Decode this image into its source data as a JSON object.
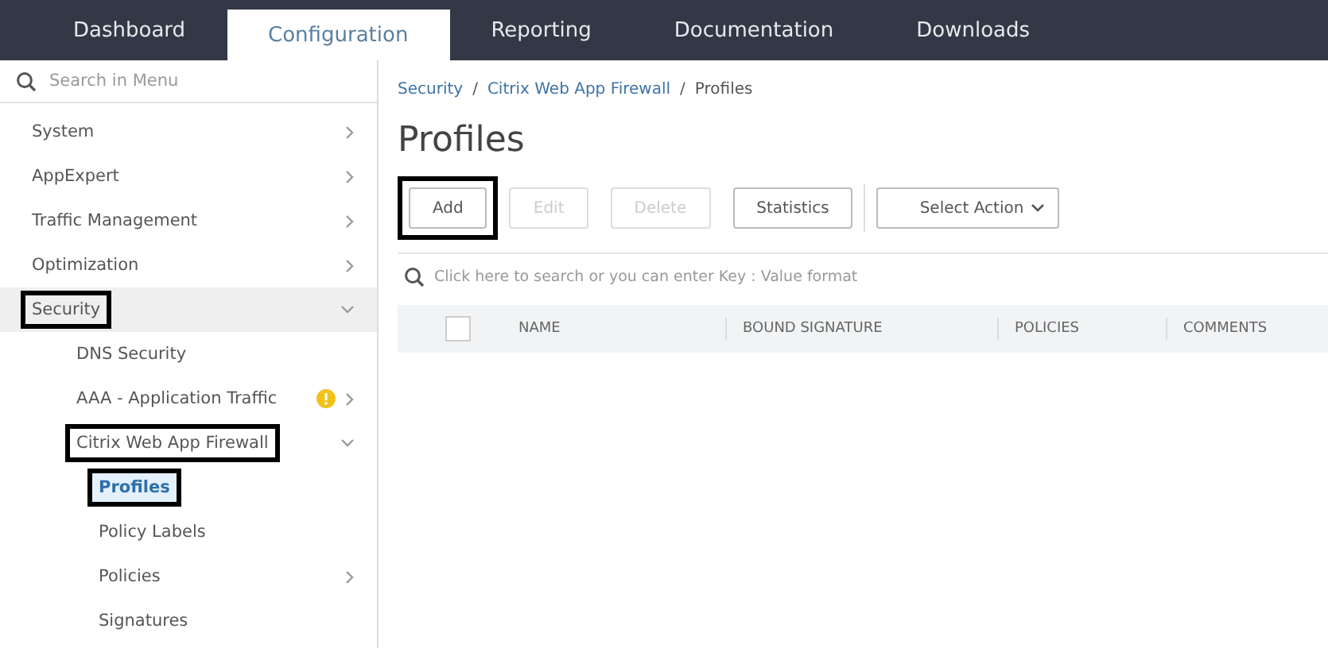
{
  "top_nav": {
    "tabs": [
      {
        "label": "Dashboard",
        "selected": false
      },
      {
        "label": "Configuration",
        "selected": true
      },
      {
        "label": "Reporting",
        "selected": false
      },
      {
        "label": "Documentation",
        "selected": false
      },
      {
        "label": "Downloads",
        "selected": false
      }
    ]
  },
  "sidebar": {
    "search": {
      "placeholder": "Search in Menu"
    },
    "items": [
      {
        "label": "System",
        "kind": "folder",
        "expanded": false,
        "selected": false,
        "highlighted": false,
        "alert": false
      },
      {
        "label": "AppExpert",
        "kind": "folder",
        "expanded": false,
        "selected": false,
        "highlighted": false,
        "alert": false
      },
      {
        "label": "Traffic Management",
        "kind": "folder",
        "expanded": false,
        "selected": false,
        "highlighted": false,
        "alert": false
      },
      {
        "label": "Optimization",
        "kind": "folder",
        "expanded": false,
        "selected": false,
        "highlighted": false,
        "alert": false
      },
      {
        "label": "Security",
        "kind": "folder",
        "expanded": true,
        "selected": false,
        "highlighted": true,
        "alert": false,
        "children": [
          {
            "label": "DNS Security",
            "kind": "page",
            "selected": false,
            "highlighted": false,
            "alert": false
          },
          {
            "label": "AAA - Application Traffic",
            "kind": "folder",
            "expanded": false,
            "selected": false,
            "highlighted": false,
            "alert": true
          },
          {
            "label": "Citrix Web App Firewall",
            "kind": "folder",
            "expanded": true,
            "selected": false,
            "highlighted": true,
            "alert": false,
            "children": [
              {
                "label": "Profiles",
                "kind": "page",
                "selected": true,
                "highlighted": true,
                "alert": false
              },
              {
                "label": "Policy Labels",
                "kind": "page",
                "selected": false,
                "highlighted": false,
                "alert": false
              },
              {
                "label": "Policies",
                "kind": "folder",
                "expanded": false,
                "selected": false,
                "highlighted": false,
                "alert": false
              },
              {
                "label": "Signatures",
                "kind": "page",
                "selected": false,
                "highlighted": false,
                "alert": false
              }
            ]
          }
        ]
      }
    ]
  },
  "main": {
    "breadcrumb": [
      {
        "label": "Security",
        "kind": "link"
      },
      {
        "label": "/",
        "kind": "separator"
      },
      {
        "label": "Citrix Web App Firewall",
        "kind": "link"
      },
      {
        "label": "/",
        "kind": "separator"
      },
      {
        "label": "Profiles",
        "kind": "current"
      }
    ],
    "title": "Profiles",
    "toolbar": [
      {
        "label": "Add",
        "kind": "button",
        "disabled": false,
        "highlighted": true
      },
      {
        "label": "Edit",
        "kind": "button",
        "disabled": true,
        "highlighted": false
      },
      {
        "label": "Delete",
        "kind": "button",
        "disabled": true,
        "highlighted": false
      },
      {
        "label": "Statistics",
        "kind": "button",
        "disabled": false,
        "highlighted": false
      },
      {
        "label": "Select Action",
        "kind": "dropdown",
        "disabled": false,
        "highlighted": false
      }
    ],
    "search": {
      "placeholder": "Click here to search or you can enter Key : Value format"
    },
    "table": {
      "select_all_checked": false,
      "columns": [
        "NAME",
        "BOUND SIGNATURE",
        "POLICIES",
        "COMMENTS"
      ]
    }
  }
}
